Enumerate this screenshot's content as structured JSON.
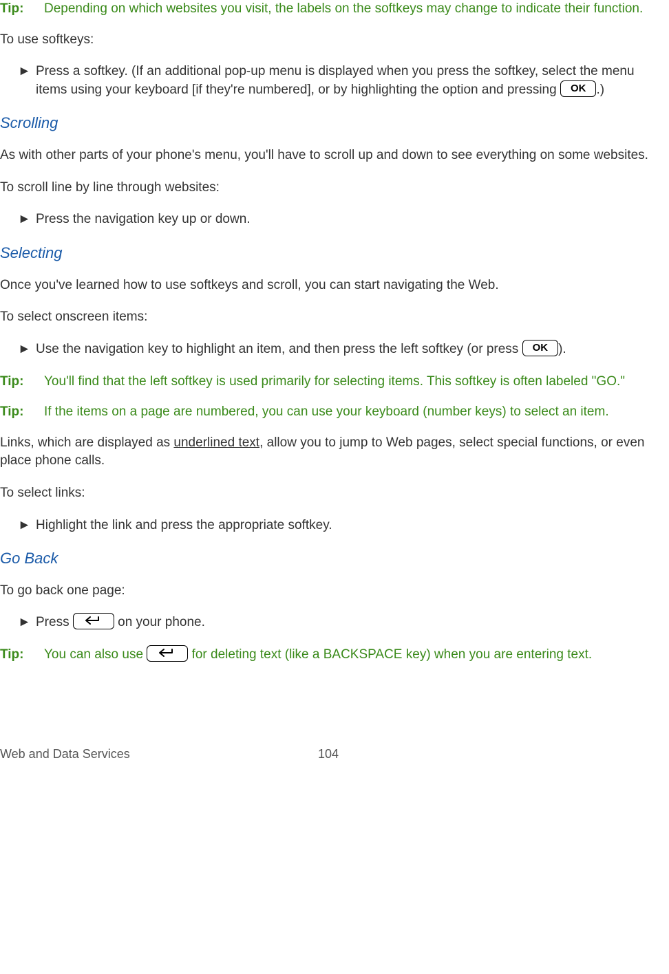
{
  "tip_label": "Tip:",
  "bullet_marker": "►",
  "key_ok": "OK",
  "tips": {
    "t0": "Depending on which websites you visit, the labels on the softkeys may change to indicate their function.",
    "t1": "You'll find that the left softkey is used primarily for selecting items. This softkey is often labeled \"GO.\"",
    "t2": "If the items on a page are numbered, you can use your keyboard (number keys) to select an item.",
    "t3a": "You can also use ",
    "t3b": " for deleting text (like a BACKSPACE key) when you are entering text."
  },
  "paras": {
    "p0": "To use softkeys:",
    "p1a": "Press a softkey. (If an additional pop-up menu is displayed when you press the softkey, select the menu items using your keyboard [if they're numbered], or by highlighting the option and pressing ",
    "p1b": ".)",
    "p2": "As with other parts of your phone's menu, you'll have to scroll up and down to see everything on some websites.",
    "p3": "To scroll line by line through websites:",
    "p4": "Press the navigation key up or down.",
    "p5": "Once you've learned how to use softkeys and scroll, you can start navigating the Web.",
    "p6": "To select onscreen items:",
    "p7a": "Use the navigation key to highlight an item, and then press the left softkey (or press ",
    "p7b": ").",
    "p8a": "Links, which are displayed as ",
    "p8u": "underlined text",
    "p8b": ", allow you to jump to Web pages, select special functions, or even place phone calls.",
    "p9": "To select links:",
    "p10": "Highlight the link and press the appropriate softkey.",
    "p11": "To go back one page:",
    "p12a": "Press ",
    "p12b": " on your phone."
  },
  "headings": {
    "h_scrolling": "Scrolling",
    "h_selecting": "Selecting",
    "h_goback": "Go Back"
  },
  "footer": {
    "section": "Web and Data Services",
    "page": "104"
  }
}
